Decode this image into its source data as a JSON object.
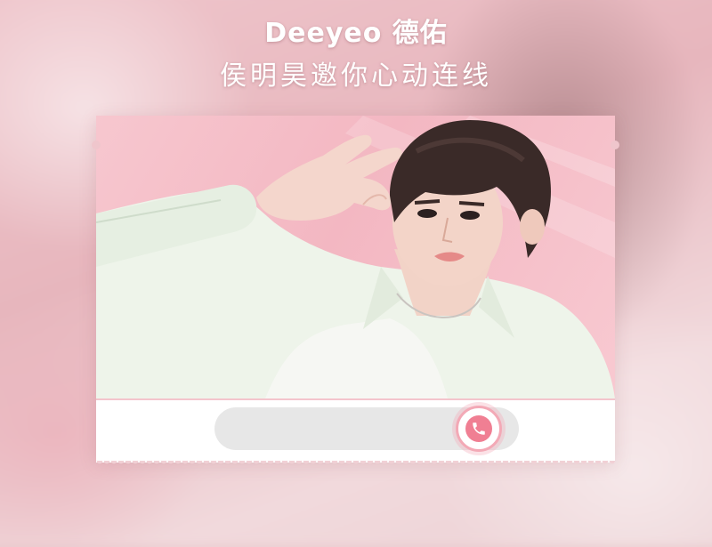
{
  "brand": {
    "text": "Deeyeo 德佑"
  },
  "headline": {
    "text": "侯明昊邀你心动连线"
  },
  "call_widget": {
    "answer_icon": "phone-icon"
  },
  "colors": {
    "accent_pink": "#f07f93",
    "ring_pink": "#f3a9b6",
    "track_gray": "#e7e7e7",
    "card_background": "#ffffff",
    "photo_background": "#f7c7cf"
  }
}
